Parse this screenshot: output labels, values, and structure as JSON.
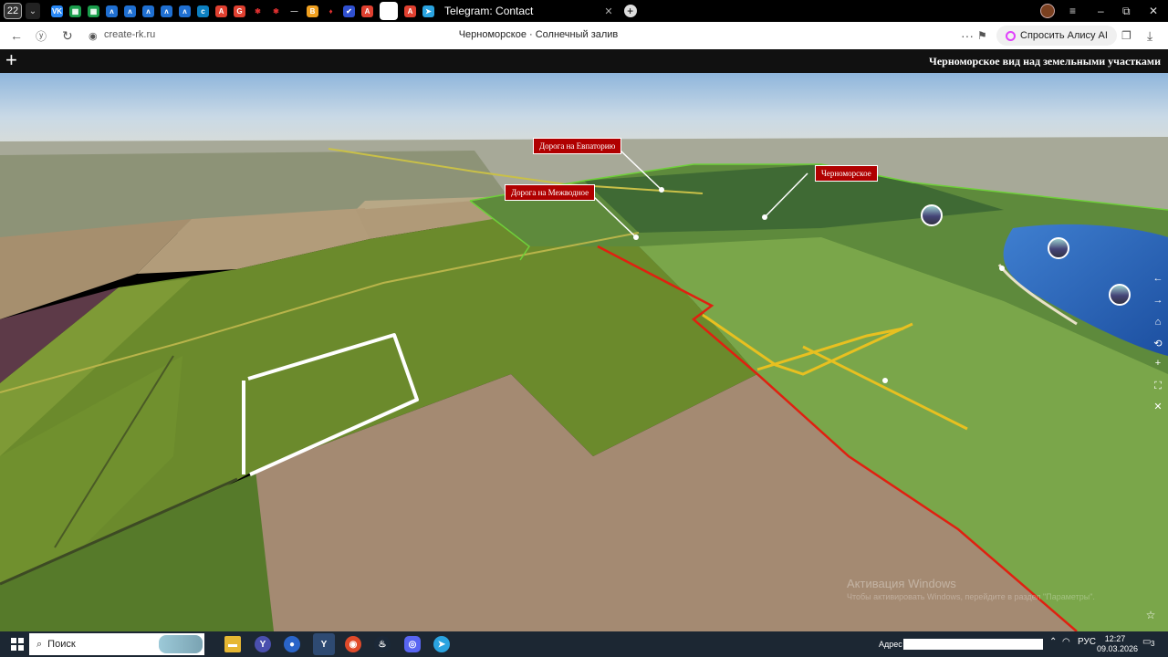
{
  "browser": {
    "tab_count": "22",
    "active_tab_title": "Telegram: Contact",
    "url": "create-rk.ru",
    "page_title": "Черноморское · Солнечный залив",
    "alice_button": "Спросить Алису AI",
    "tab_icon_letters": [
      "VK",
      "▦",
      "▦",
      "ᴧ",
      "ᴧ",
      "ᴧ",
      "ᴧ",
      "ᴧ",
      "ᴄ",
      "A",
      "G",
      "✱",
      "✱",
      "—",
      "B",
      "♦",
      "✔",
      "A",
      "",
      "A",
      "➤"
    ]
  },
  "site": {
    "title": "Черноморское вид над земельными участками"
  },
  "map": {
    "labels": {
      "road_evpatoria": "Дорога на Евпаторию",
      "road_mezhvodnoe": "Дорога на Межводное",
      "chernomorskoe": "Черноморское"
    },
    "watermark_line1": "Активация Windows",
    "watermark_line2": "Чтобы активировать Windows, перейдите в раздел \"Параметры\"."
  },
  "taskbar": {
    "search_placeholder": "Поиск",
    "address_label": "Адрес",
    "language": "РУС",
    "time": "12:27",
    "date": "09.03.2026",
    "notifications": "3"
  },
  "colors": {
    "boundary_red": "#e02010",
    "plot_white": "#ffffff",
    "road_yellow": "#e8c020",
    "settlement_green": "#6fd03a",
    "label_red": "#b00000"
  }
}
